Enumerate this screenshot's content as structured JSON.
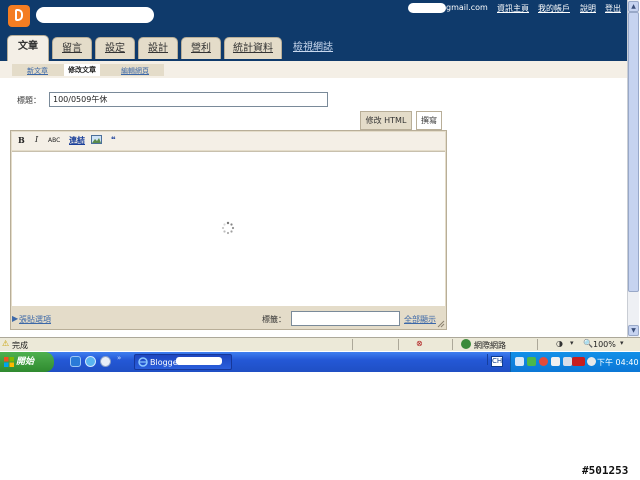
{
  "header": {
    "email_suffix": "gmail.com",
    "links": [
      "資訊主頁",
      "我的帳戶",
      "說明",
      "登出"
    ]
  },
  "tabs": [
    {
      "label": "文章",
      "active": true
    },
    {
      "label": "留言",
      "active": false
    },
    {
      "label": "設定",
      "active": false
    },
    {
      "label": "設計",
      "active": false
    },
    {
      "label": "營利",
      "active": false
    },
    {
      "label": "統計資料",
      "active": false
    },
    {
      "label": "檢視網誌",
      "active": false
    }
  ],
  "subnav": {
    "items": [
      {
        "label": "新文章",
        "active": false
      },
      {
        "label": "修改文章",
        "active": true
      },
      {
        "label": "編輯網頁",
        "active": false
      }
    ]
  },
  "post": {
    "title_label": "標題：",
    "title_value": "100/0509午休",
    "mode_html": "修改 HTML",
    "mode_compose": "撰寫",
    "toolbar": {
      "bold": "B",
      "italic": "I",
      "spell": "ABC",
      "link": "連結",
      "image_icon": "image-icon",
      "quote": "❝"
    },
    "options_link": "張貼選項",
    "labels_label": "標籤：",
    "labels_value": "",
    "show_all": "全部顯示"
  },
  "browser": {
    "status_text": "完成",
    "zone_text": "網際網路",
    "zoom_text": "100%",
    "zoom_arrow": "▾",
    "scroll_up": "▲",
    "scroll_down": "▼"
  },
  "taskbar": {
    "start_label": "開始",
    "task_label": "Blogger:",
    "clock": "下午 04:40",
    "ime_label": "CH",
    "quick_launch_icons": [
      "ie-icon",
      "mail-icon",
      "media-icon",
      "desktop-icon"
    ],
    "tray_icons": [
      "network-icon",
      "security-icon",
      "volume-icon",
      "ati-icon",
      "speaker-icon",
      "shield-icon"
    ]
  },
  "watermark": "#501253",
  "colors": {
    "header_bg": "#0f3a6b",
    "tab_bg": "#e4dcc9",
    "link": "#3c68a8",
    "taskbar": "#2458d6",
    "start_green": "#3a9a3a"
  }
}
